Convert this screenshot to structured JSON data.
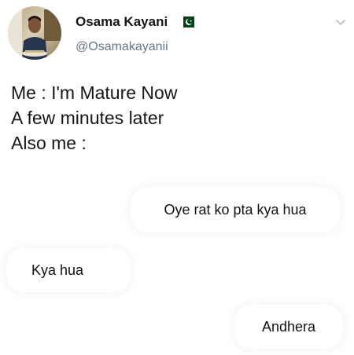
{
  "tweet": {
    "author": {
      "display_name": "Osama Kayani",
      "handle": "@Osamakayanii",
      "flag_icon": "pakistan-flag-icon",
      "avatar_icon": "profile-photo"
    },
    "menu_icon": "chevron-down-icon",
    "text_lines": [
      "Me : I'm Mature Now",
      "A few minutes later",
      "Also me :"
    ]
  },
  "chat": {
    "messages": [
      {
        "text": "Oye rat ko pta kya hua",
        "side": "right"
      },
      {
        "text": "Kya hua",
        "side": "left"
      },
      {
        "text": "Andhera",
        "side": "right"
      }
    ]
  },
  "colors": {
    "text_primary": "#14171a",
    "text_secondary": "#657786",
    "flag_green": "#01411c"
  }
}
